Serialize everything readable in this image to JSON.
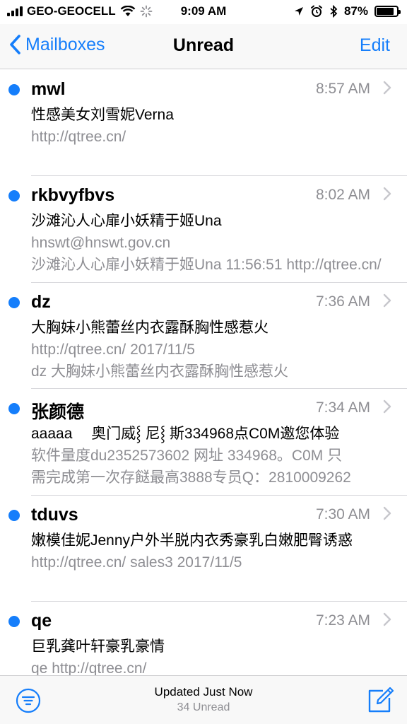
{
  "status_bar": {
    "carrier": "GEO-GEOCELL",
    "time": "9:09 AM",
    "battery": "87%",
    "battery_level": 0.87
  },
  "nav": {
    "back_label": "Mailboxes",
    "title": "Unread",
    "edit_label": "Edit"
  },
  "accent_color": "#157efb",
  "messages": [
    {
      "sender": "mwl",
      "time": "8:57 AM",
      "subject": "性感美女刘雪妮Verna",
      "preview_1": "http://qtree.cn/",
      "preview_2": ""
    },
    {
      "sender": "rkbvyfbvs",
      "time": "8:02 AM",
      "subject": "沙滩沁人心扉小妖精于姬Una",
      "preview_1": "hnswt@hnswt.gov.cn",
      "preview_2": "沙滩沁人心扉小妖精于姬Una 11:56:51 http://qtree.cn/"
    },
    {
      "sender": "dz",
      "time": "7:36 AM",
      "subject": "大胸妹小熊蕾丝内衣露酥胸性感惹火",
      "preview_1": "http://qtree.cn/ 2017/11/5",
      "preview_2": "dz 大胸妹小熊蕾丝内衣露酥胸性感惹火"
    },
    {
      "sender": "张颜德",
      "time": "7:34 AM",
      "subject": "aaaaa　 奥门威⸾ 尼⸾ 斯334968点C0M邀您体验",
      "preview_1": "软件量度du2352573602 网址 334968。C0M 只",
      "preview_2": "需完成第一次存餸最高3888专员Q：2810009262"
    },
    {
      "sender": "tduvs",
      "time": "7:30 AM",
      "subject": "嫩模佳妮Jenny户外半脱内衣秀豪乳白嫩肥臀诱惑",
      "preview_1": "http://qtree.cn/ sales3 2017/11/5",
      "preview_2": ""
    },
    {
      "sender": "qe",
      "time": "7:23 AM",
      "subject": "巨乳龚叶轩豪乳豪情",
      "preview_1": "qe http://qtree.cn/",
      "preview_2": ""
    }
  ],
  "toolbar": {
    "updated": "Updated Just Now",
    "unread_count": "34 Unread"
  }
}
